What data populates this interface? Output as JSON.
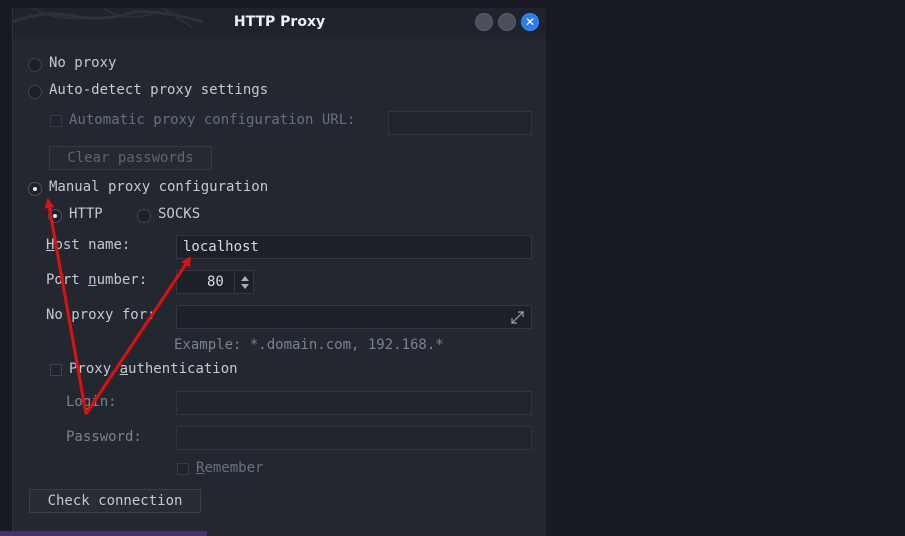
{
  "window": {
    "title": "HTTP Proxy"
  },
  "proxy": {
    "no_proxy_label": "No proxy",
    "auto_detect_label": "Auto-detect proxy settings",
    "auto_url_label": "Automatic proxy configuration URL:",
    "auto_url_value": "",
    "clear_passwords_label": "Clear passwords",
    "manual_label": "Manual proxy configuration",
    "http_label": "HTTP",
    "socks_label": "SOCKS",
    "host_label_prefix": "H",
    "host_label_rest": "ost name:",
    "host_value": "localhost",
    "port_label_prefix": "Port ",
    "port_label_accel": "n",
    "port_label_rest": "umber:",
    "port_value": "80",
    "no_proxy_for_label": "No proxy for:",
    "no_proxy_for_value": "",
    "example_text": "Example: *.domain.com, 192.168.*",
    "auth_label_prefix": "Proxy ",
    "auth_label_accel": "a",
    "auth_label_rest": "uthentication",
    "login_label": "Login:",
    "password_label": "Password:",
    "remember_accel": "R",
    "remember_rest": "emember",
    "check_connection_label": "Check connection",
    "selected_mode": "manual",
    "selected_type": "http"
  },
  "annotation": {
    "arrow_color": "#e01010"
  }
}
